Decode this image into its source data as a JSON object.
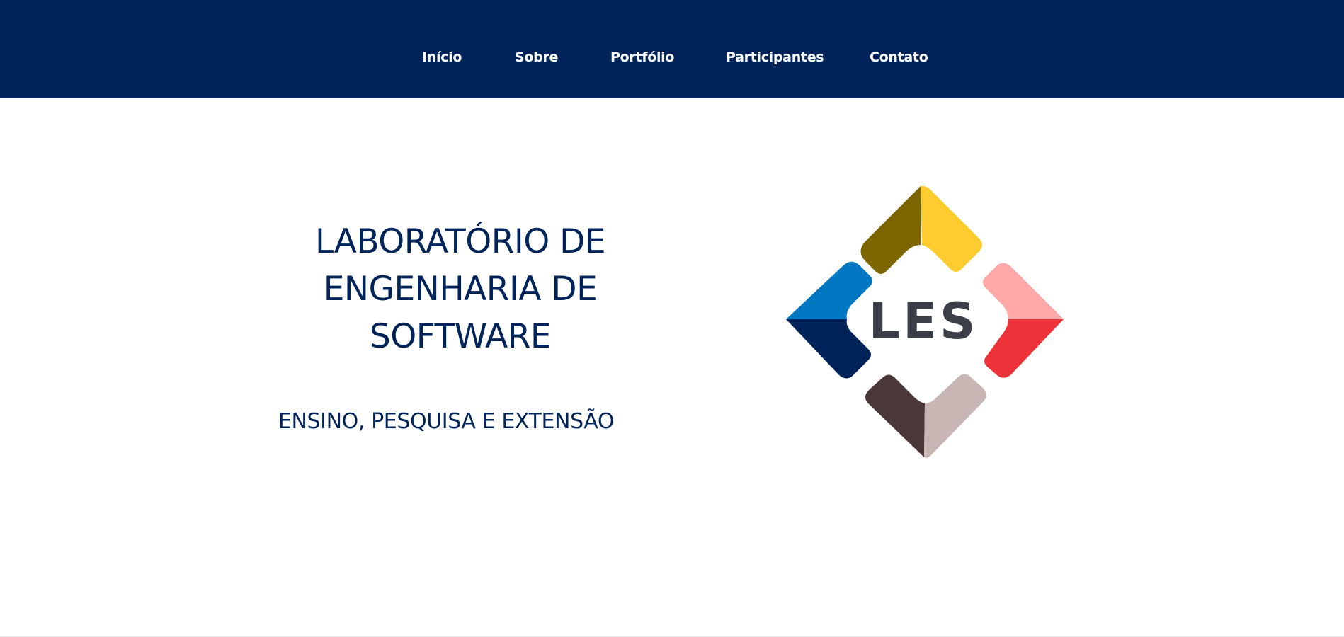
{
  "nav": {
    "items": [
      {
        "label": "Início"
      },
      {
        "label": "Sobre"
      },
      {
        "label": "Portfólio"
      },
      {
        "label": "Participantes"
      },
      {
        "label": "Contato"
      }
    ]
  },
  "hero": {
    "title": "LABORATÓRIO DE ENGENHARIA DE SOFTWARE",
    "subtitle": "ENSINO, PESQUISA E EXTENSÃO"
  },
  "logo": {
    "text": "LES",
    "colors": {
      "top_left": "#7d6500",
      "top_right": "#ffcc2f",
      "left_top": "#0077c0",
      "left_bottom": "#00245a",
      "right_top": "#ffa8a8",
      "right_bottom": "#ee3239",
      "bottom_left": "#4a3838",
      "bottom_right": "#c8b6b5",
      "text": "#3a3f48"
    }
  },
  "colors": {
    "header_bg": "#00245a",
    "nav_text": "#ffffff",
    "hero_text": "#00245a",
    "page_bg": "#ffffff"
  }
}
